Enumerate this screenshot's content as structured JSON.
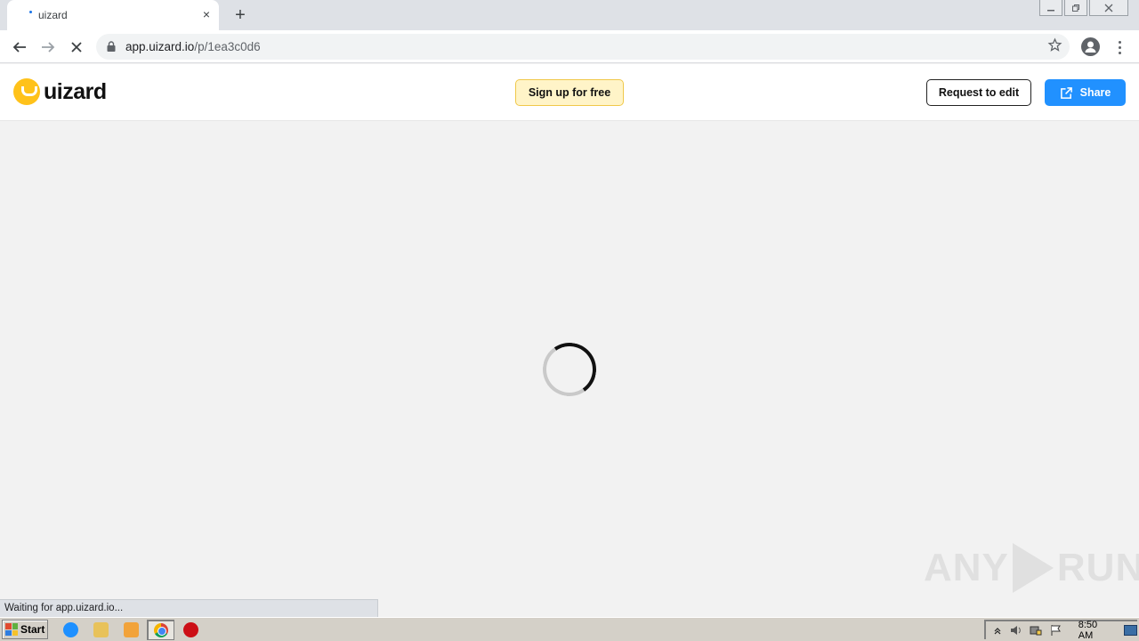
{
  "browser": {
    "tab_title": "uizard",
    "tab_close_glyph": "×",
    "new_tab_glyph": "+",
    "url_host": "app.uizard.io",
    "url_path": "/p/1ea3c0d6",
    "status_text": "Waiting for app.uizard.io..."
  },
  "header": {
    "logo_text": "uizard",
    "signup_label": "Sign up for free",
    "request_label": "Request to edit",
    "share_label": "Share"
  },
  "watermark": {
    "left": "ANY",
    "right": "RUN"
  },
  "taskbar": {
    "start_label": "Start",
    "clock": "8:50 AM"
  },
  "colors": {
    "accent_yellow": "#ffc21a",
    "share_blue": "#2191ff"
  }
}
